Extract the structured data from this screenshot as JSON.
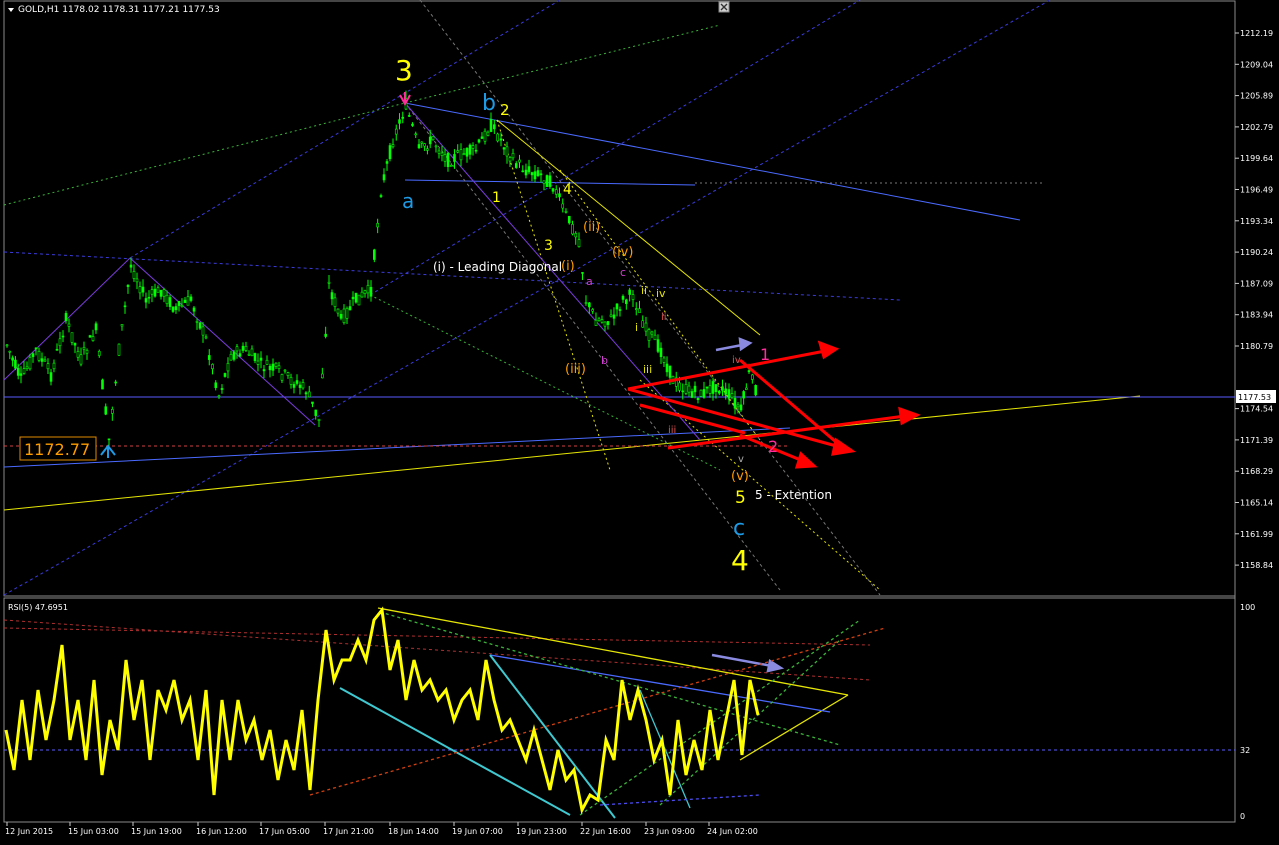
{
  "window": {
    "symbol_line": "GOLD,H1  1178.02 1178.31 1177.21 1177.53",
    "menu_icon": "triangle-down-icon",
    "close_icon": "close-icon"
  },
  "price_axis": {
    "ticks": [
      "1212.19",
      "1209.04",
      "1205.89",
      "1202.79",
      "1199.64",
      "1196.49",
      "1193.34",
      "1190.24",
      "1187.09",
      "1183.94",
      "1180.79",
      "1177.53",
      "1174.54",
      "1171.39",
      "1168.29",
      "1165.14",
      "1161.99",
      "1158.84"
    ],
    "current_price": "1177.53"
  },
  "rsi": {
    "title": "RSI(5) 47.6951",
    "levels": [
      "100",
      "32",
      "0"
    ]
  },
  "time_axis": {
    "labels": [
      "12 Jun 2015",
      "15 Jun 03:00",
      "15 Jun 19:00",
      "16 Jun 12:00",
      "17 Jun 05:00",
      "17 Jun 21:00",
      "18 Jun 14:00",
      "19 Jun 07:00",
      "19 Jun 23:00",
      "22 Jun 16:00",
      "23 Jun 09:00",
      "24 Jun 02:00"
    ]
  },
  "annotations": {
    "low_price_box": "1172.77",
    "wave3_main": "3",
    "wave4_main": "4",
    "wave5": "5",
    "wave_a": "a",
    "wave_b": "b",
    "wave_c": "c",
    "wave_b2": "2",
    "sub1": "1",
    "sub3": "3",
    "sub4": "4",
    "i_paren": "(i)",
    "ii_paren": "(ii)",
    "iii_paren": "(iii)",
    "iv_paren": "(iv)",
    "v_paren": "(v)",
    "leading_diagonal": "(i) - Leading Diagonal",
    "extension": "5 - Extention",
    "small_a": "a",
    "small_b": "b",
    "small_c": "c",
    "roman_i": "i",
    "roman_ii": "ii",
    "roman_iii": "iii",
    "roman_iv": "iv",
    "roman_iii_red": "iii",
    "roman_iv_red": "iv",
    "roman_v": "v",
    "roman_i_white": "i",
    "roman_ii_white": "ii",
    "pink1": "1",
    "pink2": "2"
  },
  "colors": {
    "background": "#000000",
    "bull_candle": "#00ff00",
    "grid_text": "#ffffff",
    "rsi_line": "#ffff00",
    "arrows": "#ff0000",
    "yellow_label": "#ffff00",
    "cyan_label": "#1e9be6",
    "orange_label": "#ff9c00",
    "pink_label": "#ff2d9b"
  }
}
